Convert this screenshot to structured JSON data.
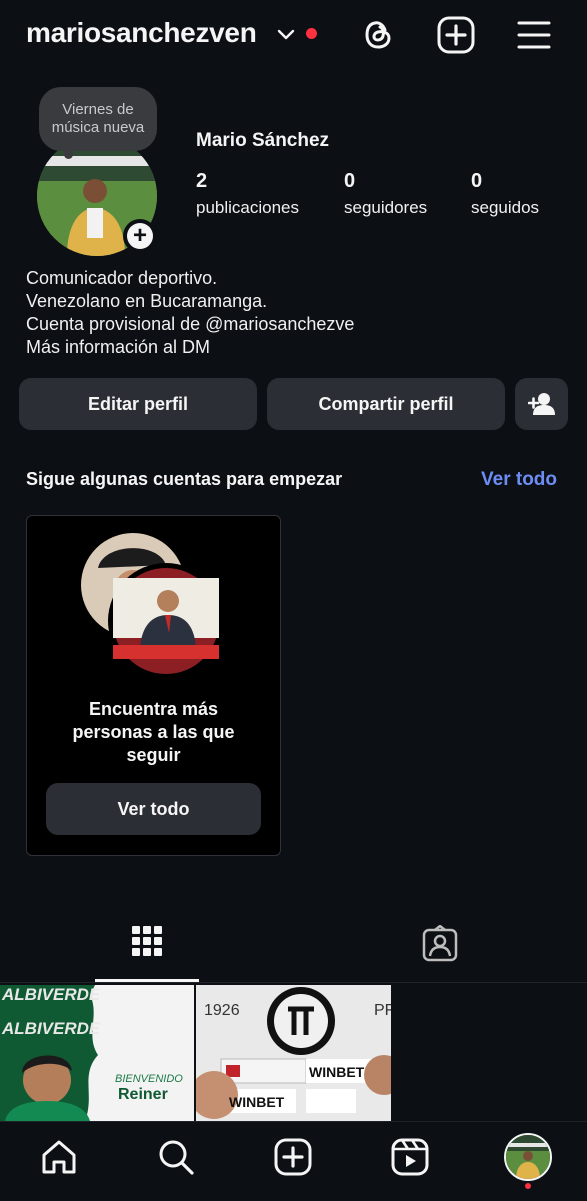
{
  "header": {
    "username": "mariosanchezven"
  },
  "profile": {
    "note": "Viernes de música nueva",
    "full_name": "Mario Sánchez",
    "stats": [
      {
        "value": "2",
        "label": "publicaciones"
      },
      {
        "value": "0",
        "label": "seguidores"
      },
      {
        "value": "0",
        "label": "seguidos"
      }
    ],
    "bio": [
      "Comunicador deportivo.",
      "Venezolano en Bucaramanga.",
      "Cuenta provisional de @mariosanchezve",
      "Más información al DM"
    ]
  },
  "actions": {
    "edit": "Editar perfil",
    "share": "Compartir perfil"
  },
  "suggestions": {
    "title": "Sigue algunas cuentas para empezar",
    "see_all": "Ver todo",
    "card_text": "Encuentra más personas a las que seguir",
    "card_button": "Ver todo"
  },
  "posts": [
    {
      "texts": [
        "ALBIVERDE",
        "BIENVENIDO",
        "Reiner"
      ]
    },
    {
      "texts": [
        "1926",
        "WINBET",
        "WINBET",
        "PF"
      ]
    }
  ],
  "colors": {
    "background": "#0c0f14",
    "button": "#2b2e34",
    "link": "#6d8df5",
    "notification": "#ff3040"
  }
}
